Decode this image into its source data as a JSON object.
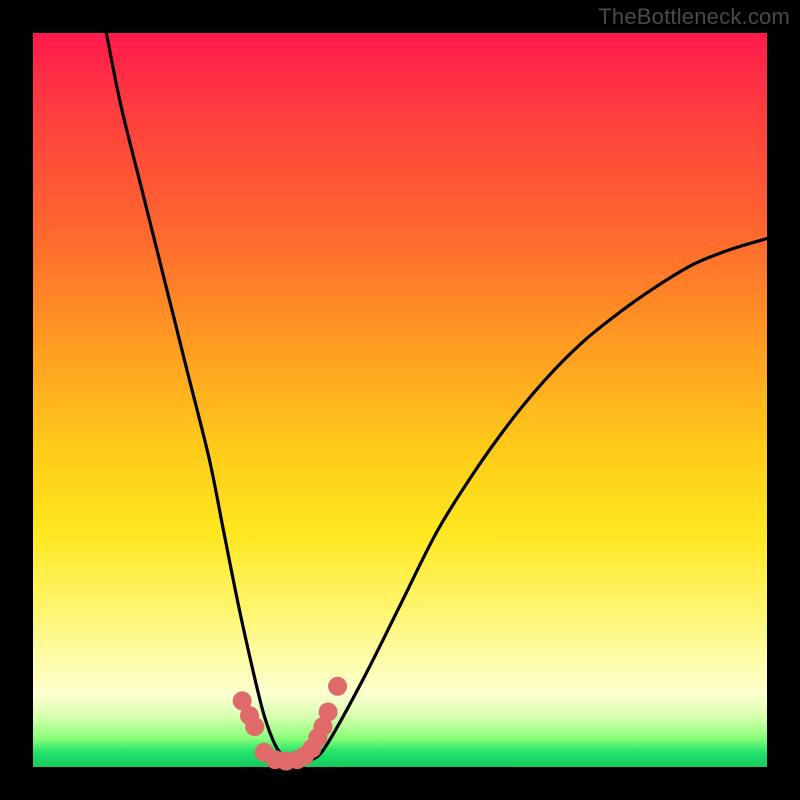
{
  "watermark": "TheBottleneck.com",
  "colors": {
    "frame": "#000000",
    "curve": "#000000",
    "markers": "#e06a6a",
    "gradient_top": "#ff1a4d",
    "gradient_bottom": "#17c85c"
  },
  "chart_data": {
    "type": "line",
    "title": "",
    "xlabel": "",
    "ylabel": "",
    "xlim": [
      0,
      100
    ],
    "ylim": [
      0,
      100
    ],
    "grid": false,
    "legend": false,
    "series": [
      {
        "name": "bottleneck-curve",
        "x": [
          10,
          12,
          15,
          18,
          21,
          24,
          26,
          28,
          30,
          31.5,
          33,
          34.5,
          36,
          38,
          40,
          45,
          50,
          55,
          60,
          65,
          70,
          75,
          80,
          85,
          90,
          95,
          100
        ],
        "y": [
          100,
          90,
          78,
          66,
          54,
          42,
          32,
          22,
          13,
          7,
          3,
          1,
          0.5,
          1,
          3,
          12,
          22,
          32,
          40,
          47,
          53,
          58,
          62,
          65.5,
          68.5,
          70.5,
          72
        ]
      }
    ],
    "markers": {
      "name": "highlight-points",
      "x": [
        28.5,
        29.5,
        30.2,
        31.5,
        33.0,
        34.5,
        36.0,
        37.0,
        38.0,
        38.8,
        39.5,
        40.2,
        41.5
      ],
      "y": [
        9.0,
        7.0,
        5.5,
        2.0,
        1.0,
        0.8,
        1.0,
        1.5,
        2.5,
        4.0,
        5.5,
        7.5,
        11.0
      ]
    }
  }
}
